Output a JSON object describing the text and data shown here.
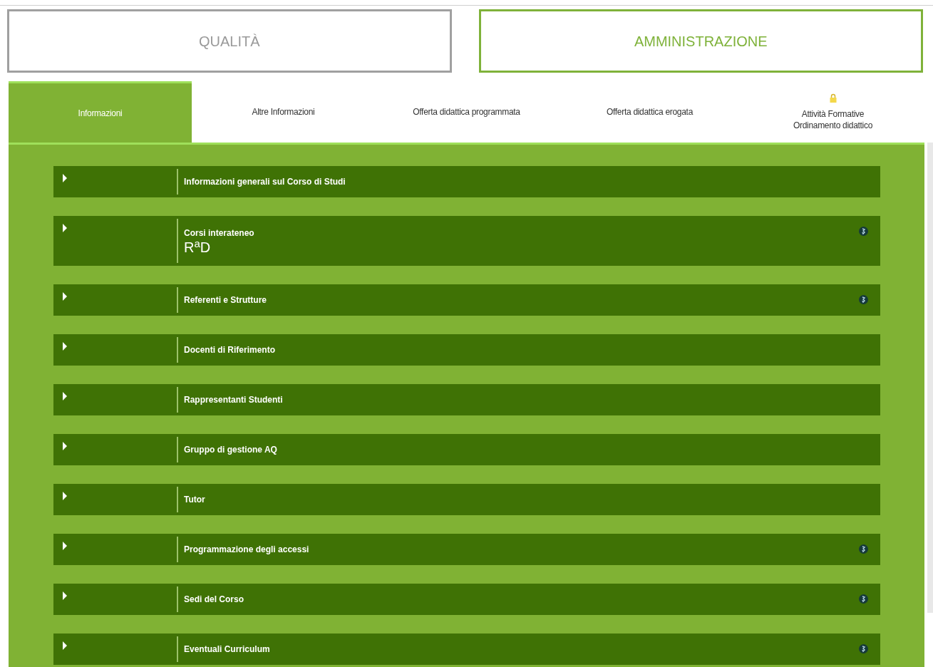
{
  "sections": [
    {
      "label": "QUALITÀ",
      "selected": false
    },
    {
      "label": "AMMINISTRAZIONE",
      "selected": true
    }
  ],
  "tabs": [
    {
      "label": "Informazioni",
      "selected": true,
      "locked": false
    },
    {
      "label": "Altre Informazioni",
      "selected": false,
      "locked": false
    },
    {
      "label": "Offerta didattica programmata",
      "selected": false,
      "locked": false
    },
    {
      "label": "Offerta didattica erogata",
      "selected": false,
      "locked": false
    },
    {
      "label": "Attività Formative\nOrdinamento didattico",
      "selected": false,
      "locked": true
    }
  ],
  "rows": [
    {
      "title": "Informazioni generali sul Corso di Studi",
      "badge": false
    },
    {
      "title": "Corsi interateneo",
      "logo": "R$^{a}$D",
      "badge": true
    },
    {
      "title": "Referenti e Strutture",
      "badge": true
    },
    {
      "title": "Docenti di Riferimento",
      "badge": false
    },
    {
      "title": "Rappresentanti Studenti",
      "badge": false
    },
    {
      "title": "Gruppo di gestione AQ",
      "badge": false
    },
    {
      "title": "Tutor",
      "badge": false
    },
    {
      "title": "Programmazione degli accessi",
      "badge": true
    },
    {
      "title": "Sedi del Corso",
      "badge": true
    },
    {
      "title": "Eventuali Curriculum",
      "badge": true
    }
  ]
}
